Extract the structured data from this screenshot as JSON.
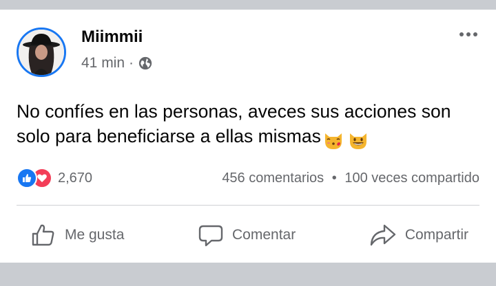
{
  "post": {
    "author": "Miimmii",
    "time": "41 min",
    "separator": "·",
    "privacy_icon": "globe-icon",
    "text": "No confíes en las personas, aveces sus acciones son solo para beneficiarse a ellas mismas",
    "emojis": [
      "kissing-cat-emoji",
      "grinning-cat-emoji"
    ]
  },
  "stats": {
    "reaction_icons": [
      "like-reaction-icon",
      "love-reaction-icon"
    ],
    "reaction_count": "2,670",
    "comments": "456 comentarios",
    "dot": "•",
    "shares": "100 veces compartido"
  },
  "actions": {
    "like": "Me gusta",
    "comment": "Comentar",
    "share": "Compartir"
  },
  "colors": {
    "accent": "#1877f2",
    "love": "#f33e58",
    "secondary_text": "#65676b",
    "background": "#c9ccd1"
  }
}
